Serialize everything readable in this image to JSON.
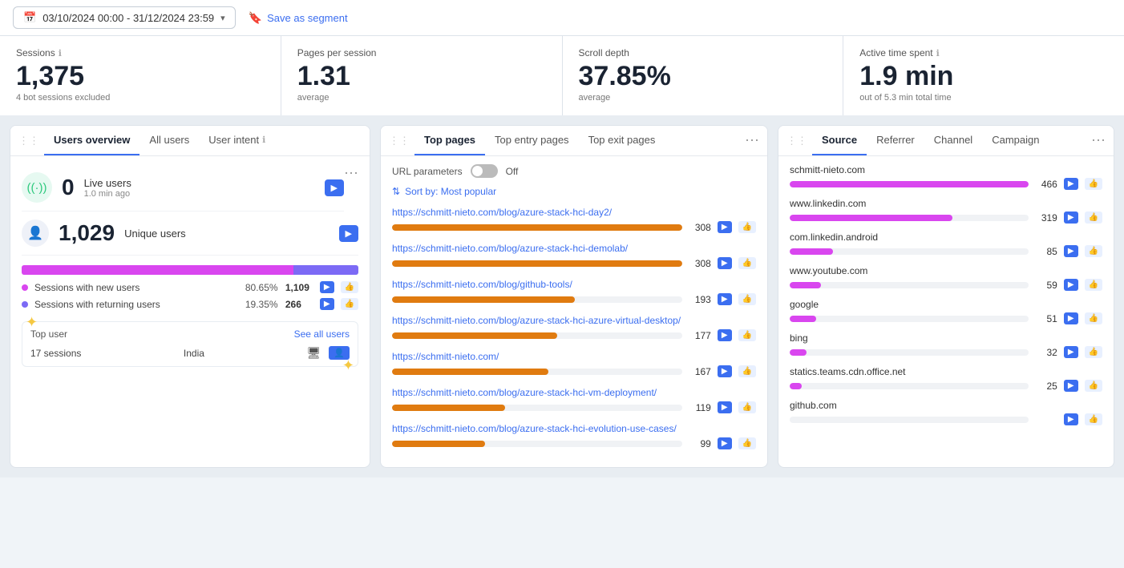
{
  "topbar": {
    "date_range": "03/10/2024 00:00 - 31/12/2024 23:59",
    "save_segment": "Save as segment"
  },
  "metrics": [
    {
      "label": "Sessions",
      "has_info": true,
      "value": "1,375",
      "sub": "4 bot sessions excluded"
    },
    {
      "label": "Pages per session",
      "has_info": false,
      "value": "1.31",
      "sub": "average"
    },
    {
      "label": "Scroll depth",
      "has_info": false,
      "value": "37.85%",
      "sub": "average"
    },
    {
      "label": "Active time spent",
      "has_info": true,
      "value": "1.9 min",
      "sub": "out of 5.3 min total time"
    }
  ],
  "users_panel": {
    "tabs": [
      "Users overview",
      "All users",
      "User intent"
    ],
    "active_tab": "Users overview",
    "live_users": {
      "count": "0",
      "label": "Live users",
      "time": "1.0 min ago"
    },
    "unique_users": {
      "count": "1,029",
      "label": "Unique users"
    },
    "sessions_new_pct": "80.65%",
    "sessions_new_count": "1,109",
    "sessions_returning_pct": "19.35%",
    "sessions_returning_count": "266",
    "sessions_new_label": "Sessions with new users",
    "sessions_returning_label": "Sessions with returning users",
    "top_user": {
      "title": "Top user",
      "see_all": "See all users",
      "sessions": "17 sessions",
      "country": "India"
    }
  },
  "pages_panel": {
    "tabs": [
      "Top pages",
      "Top entry pages",
      "Top exit pages"
    ],
    "active_tab": "Top pages",
    "url_params_label": "URL parameters",
    "url_params_value": "Off",
    "sort_label": "Sort by: Most popular",
    "pages": [
      {
        "url": "https://schmitt-nieto.com/blog/azure-stack-hci-day2/",
        "count": 308,
        "bar_pct": 100
      },
      {
        "url": "https://schmitt-nieto.com/blog/azure-stack-hci-demolab/",
        "count": 308,
        "bar_pct": 100
      },
      {
        "url": "https://schmitt-nieto.com/blog/github-tools/",
        "count": 193,
        "bar_pct": 63
      },
      {
        "url": "https://schmitt-nieto.com/blog/azure-stack-hci-azure-virtual-desktop/",
        "count": 177,
        "bar_pct": 57
      },
      {
        "url": "https://schmitt-nieto.com/",
        "count": 167,
        "bar_pct": 54
      },
      {
        "url": "https://schmitt-nieto.com/blog/azure-stack-hci-vm-deployment/",
        "count": 119,
        "bar_pct": 39
      },
      {
        "url": "https://schmitt-nieto.com/blog/azure-stack-hci-evolution-use-cases/",
        "count": 99,
        "bar_pct": 32
      }
    ]
  },
  "source_panel": {
    "tabs": [
      "Source",
      "Referrer",
      "Channel",
      "Campaign"
    ],
    "active_tab": "Source",
    "sources": [
      {
        "name": "schmitt-nieto.com",
        "count": 466,
        "bar_pct": 100
      },
      {
        "name": "www.linkedin.com",
        "count": 319,
        "bar_pct": 68
      },
      {
        "name": "com.linkedin.android",
        "count": 85,
        "bar_pct": 18
      },
      {
        "name": "www.youtube.com",
        "count": 59,
        "bar_pct": 13
      },
      {
        "name": "google",
        "count": 51,
        "bar_pct": 11
      },
      {
        "name": "bing",
        "count": 32,
        "bar_pct": 7
      },
      {
        "name": "statics.teams.cdn.office.net",
        "count": 25,
        "bar_pct": 5
      },
      {
        "name": "github.com",
        "count": 0,
        "bar_pct": 0
      }
    ]
  },
  "icons": {
    "video": "▶",
    "thumbs_up": "👍",
    "chevron_down": "▾",
    "sort": "⇅",
    "more": "⋯",
    "drag": "⋮⋮",
    "star": "✦",
    "monitor": "🖥",
    "user": "👤",
    "live_signal": "((•))"
  },
  "colors": {
    "new_users_bar": "#d946ef",
    "returning_users_bar": "#7c6af5",
    "page_bar": "#e07b10",
    "source_bar_top": "#d946ef",
    "blue": "#3b6ef0"
  }
}
